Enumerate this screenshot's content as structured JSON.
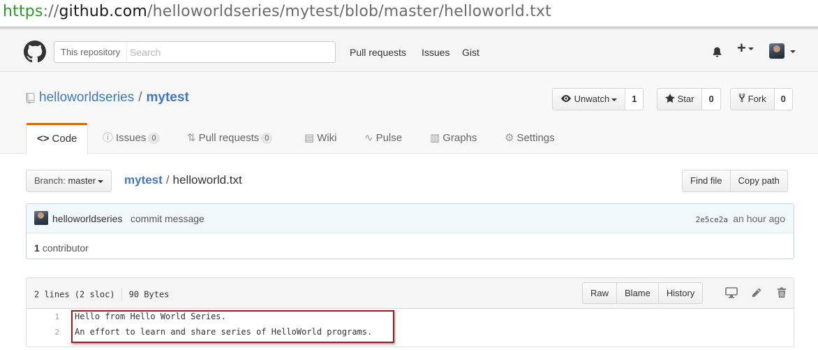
{
  "browser": {
    "url_scheme": "https",
    "url_sep": "://",
    "url_host": "github.com",
    "url_path": "/helloworldseries/mytest/blob/master/helloworld.txt"
  },
  "header": {
    "search_scope": "This repository",
    "search_placeholder": "Search",
    "nav": [
      "Pull requests",
      "Issues",
      "Gist"
    ],
    "plus_label": "+"
  },
  "repo": {
    "owner": "helloworldseries",
    "separator": "/",
    "name": "mytest",
    "watch": {
      "label": "Unwatch",
      "count": "1"
    },
    "star": {
      "label": "Star",
      "count": "0"
    },
    "fork": {
      "label": "Fork",
      "count": "0"
    },
    "tabs": [
      {
        "label": "Code",
        "icon": "code-icon",
        "selected": true
      },
      {
        "label": "Issues",
        "count": "0",
        "icon": "issue-icon"
      },
      {
        "label": "Pull requests",
        "count": "0",
        "icon": "pull-request-icon"
      },
      {
        "label": "Wiki",
        "icon": "book-icon"
      },
      {
        "label": "Pulse",
        "icon": "pulse-icon"
      },
      {
        "label": "Graphs",
        "icon": "graph-icon"
      },
      {
        "label": "Settings",
        "icon": "gear-icon"
      }
    ]
  },
  "file_nav": {
    "branch_prefix": "Branch:",
    "branch": "master",
    "breadcrumb_repo": "mytest",
    "breadcrumb_sep": "/",
    "breadcrumb_file": "helloworld.txt",
    "find_file": "Find file",
    "copy_path": "Copy path"
  },
  "commit": {
    "author": "helloworldseries",
    "message": "commit message",
    "sha": "2e5ce2a",
    "time": "an hour ago",
    "contributors_count": "1",
    "contributors_label": "contributor"
  },
  "file": {
    "lines_info": "2 lines (2 sloc)",
    "size": "90 Bytes",
    "buttons": [
      "Raw",
      "Blame",
      "History"
    ],
    "lines": [
      {
        "num": "1",
        "text": "Hello from Hello World Series."
      },
      {
        "num": "2",
        "text": "An effort to learn and share series of HelloWorld programs."
      }
    ]
  },
  "colors": {
    "link": "#4078c0",
    "tab_accent": "#d26911",
    "highlight": "#a3161c",
    "url_scheme": "#2b9a2b"
  }
}
